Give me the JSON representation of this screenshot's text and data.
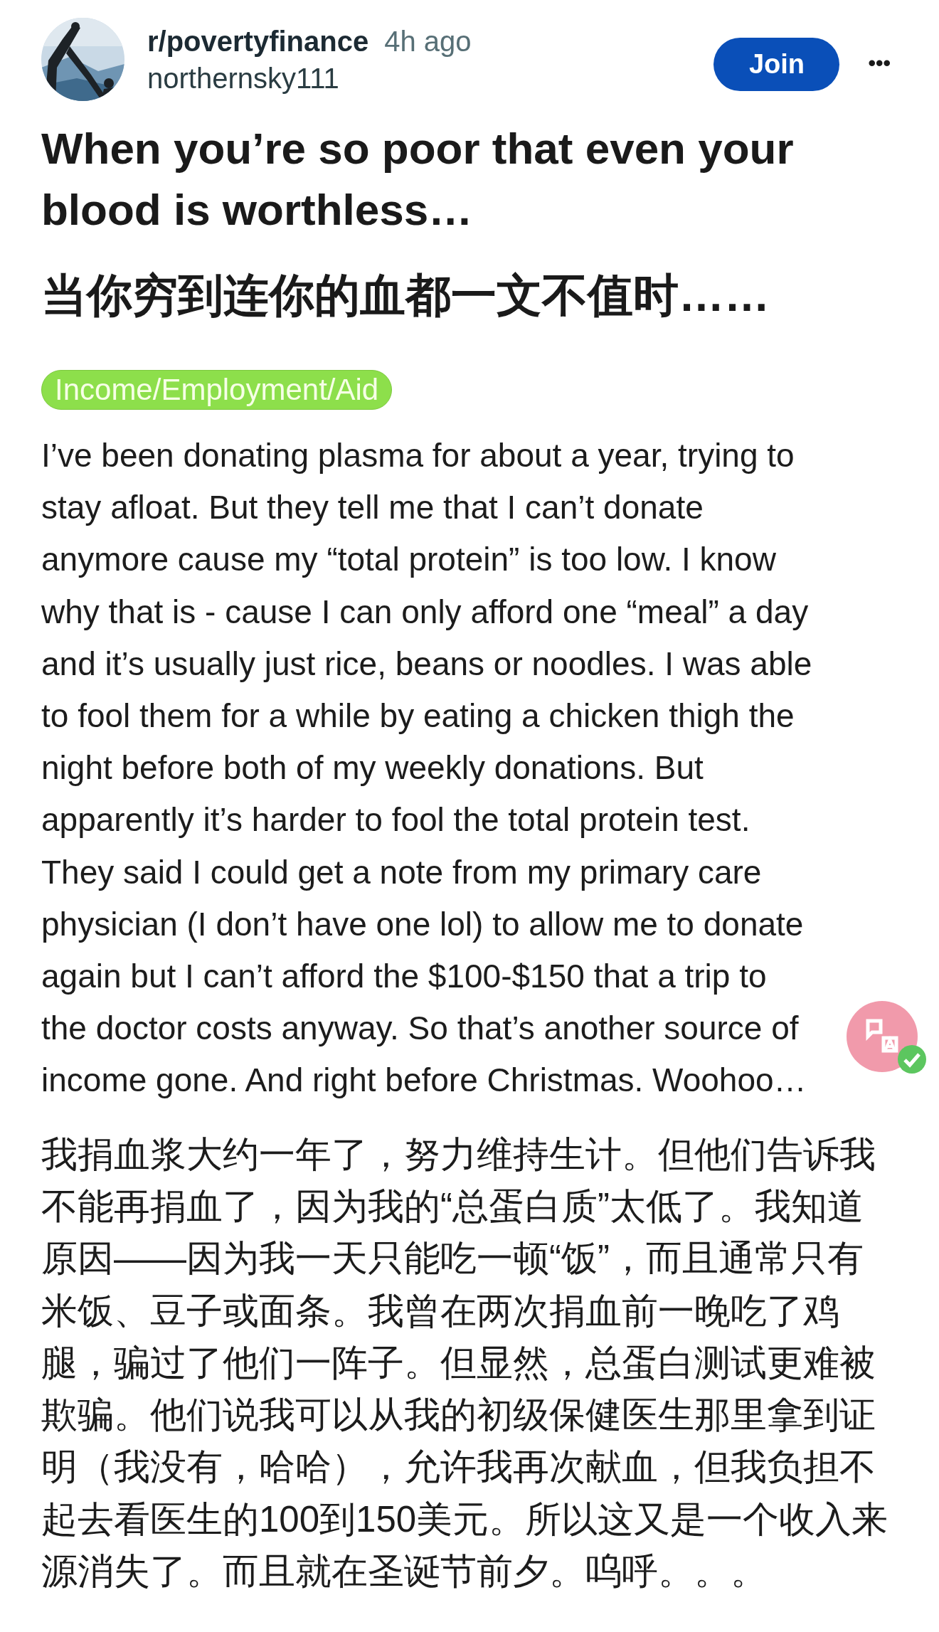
{
  "post": {
    "subreddit": "r/povertyfinance",
    "time": "4h ago",
    "author": "northernsky111",
    "join_button": "Join",
    "menu": "•••"
  },
  "title": "When you’re so poor that even your blood is worthless…",
  "title_translation": "当你穷到连你的血都一文不值时……",
  "flair": "Income/Employment/Aid",
  "body_lines": [
    "I’ve been donating plasma for about a year, trying to",
    "stay afloat. But they tell me that I can’t donate",
    "anymore cause my “total protein” is too low. I know",
    "why that is - cause I can only afford one “meal” a day",
    "and it’s usually just rice, beans or noodles. I was able",
    "to fool them for a while by eating a chicken thigh the",
    "night before both of my weekly donations. But",
    "apparently it’s harder to fool the total protein test.",
    "They said I could get a note from my primary care",
    "physician (I don’t have one lol) to allow me to donate",
    "again but I can’t afford the $100-$150 that a trip to",
    "the doctor costs anyway. So that’s another source of",
    "income gone. And right before Christmas. Woohoo…"
  ],
  "translation_lines": [
    "我捐血浆大约一年了，努力维持生计。但他们告诉我",
    "不能再捐血了，因为我的“总蛋白质”太低了。我知道",
    "原因——因为我一天只能吃一顿“饭”，而且通常只有",
    "米饭、豆子或面条。我曾在两次捐血前一晚吃了鸡",
    "腿，骗过了他们一阵子。但显然，总蛋白测试更难被",
    "欺骗。他们说我可以从我的初级保健医生那里拿到证",
    "明（我没有，哈哈），允许我再次献血，但我负担不",
    "起去看医生的100到150美元。所以这又是一个收入来",
    "源消失了。而且就在圣诞节前夕。呜呼。。。"
  ]
}
